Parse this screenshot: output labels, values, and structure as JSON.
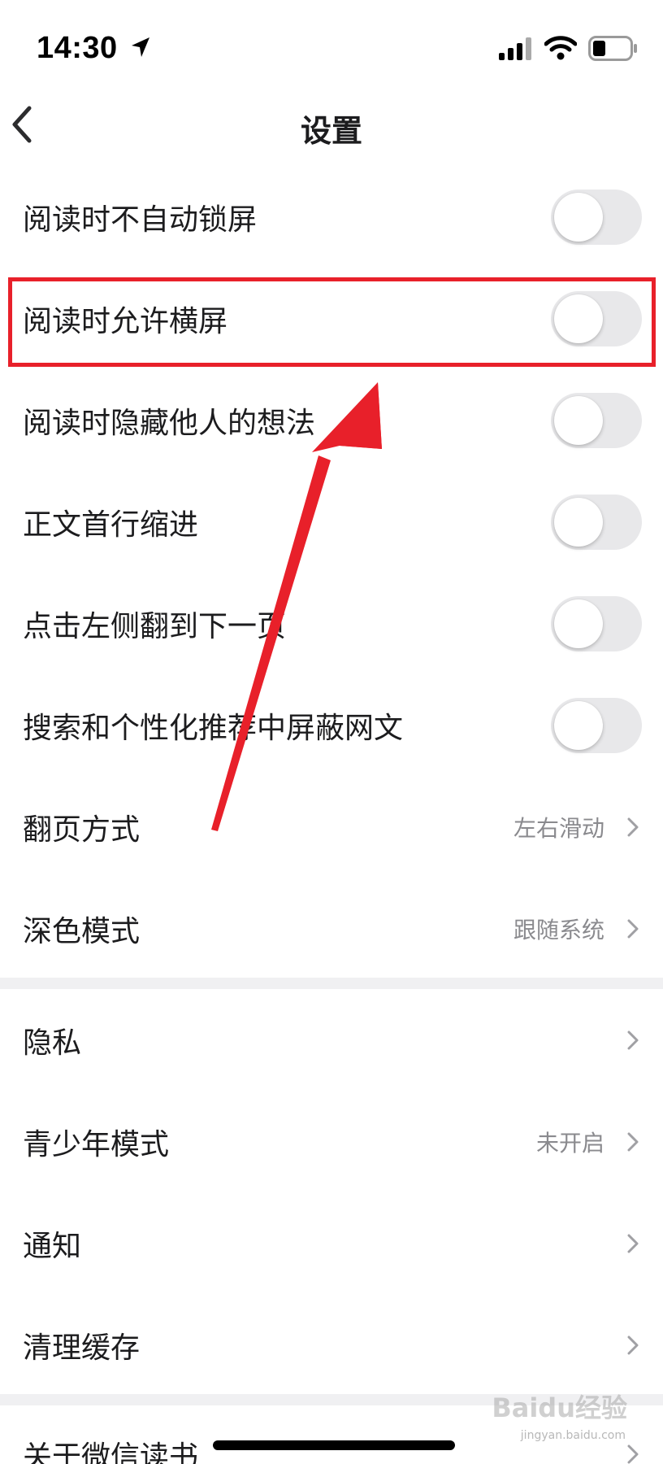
{
  "status_bar": {
    "time": "14:30",
    "icons": [
      "location-arrow-icon",
      "cellular-signal-icon",
      "wifi-icon",
      "battery-icon"
    ]
  },
  "nav": {
    "title": "设置",
    "back_icon": "chevron-left-icon"
  },
  "toggle_rows": [
    {
      "label": "阅读时不自动锁屏",
      "on": false
    },
    {
      "label": "阅读时允许横屏",
      "on": false
    },
    {
      "label": "阅读时隐藏他人的想法",
      "on": false
    },
    {
      "label": "正文首行缩进",
      "on": false
    },
    {
      "label": "点击左侧翻到下一页",
      "on": false
    },
    {
      "label": "搜索和个性化推荐中屏蔽网文",
      "on": false
    }
  ],
  "value_rows": [
    {
      "label": "翻页方式",
      "value": "左右滑动"
    },
    {
      "label": "深色模式",
      "value": "跟随系统"
    }
  ],
  "section2_rows": [
    {
      "label": "隐私",
      "value": ""
    },
    {
      "label": "青少年模式",
      "value": "未开启"
    },
    {
      "label": "通知",
      "value": ""
    },
    {
      "label": "清理缓存",
      "value": ""
    }
  ],
  "section3_rows": [
    {
      "label": "关于微信读书",
      "value": ""
    }
  ],
  "annotation": {
    "highlight_color": "#e8202a",
    "highlighted_item": "阅读时允许横屏"
  },
  "watermark": {
    "brand": "Baidu经验",
    "url": "jingyan.baidu.com"
  },
  "colors": {
    "toggle_off": "#e8e8ea",
    "divider": "#f0f0f2",
    "secondary_text": "#8a8a8e",
    "annotation_red": "#e8202a"
  }
}
